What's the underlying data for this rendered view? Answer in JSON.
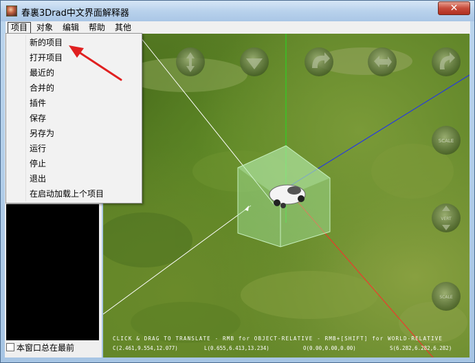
{
  "window": {
    "title": "春裏3Drad中文界面解释器",
    "close_glyph": "✕"
  },
  "menubar": {
    "items": [
      "项目",
      "对象",
      "编辑",
      "帮助",
      "其他"
    ]
  },
  "project_menu": {
    "items": [
      "新的项目",
      "打开项目",
      "最近的",
      "合并的",
      "插件",
      "保存",
      "另存为",
      "运行",
      "停止",
      "退出",
      "在启动加载上个项目"
    ]
  },
  "left_panel": {
    "always_on_top_label": "本窗口总在最前",
    "always_on_top_checked": false
  },
  "viewport": {
    "hint": "CLICK & DRAG TO TRANSLATE - RMB for OBJECT-RELATIVE - RMB+[SHIFT] for WORLD-RELATIVE",
    "coords": {
      "c": "C(2.461,9.554,12.077)",
      "l": "L(0.655,6.413,13.234)",
      "o": "O(0.00,0.00,0.00)",
      "s": "S(6.282,6.282,6.282)"
    },
    "nav_buttons": [
      "move-vertical-icon",
      "move-down-icon",
      "rotate-left-icon",
      "rotate-right-icon",
      "tilt-icon",
      "scale-icon",
      "zoom-vertical-icon",
      "scale-small-icon"
    ],
    "scale_labels": {
      "scale": "SCALE",
      "vert": "VERT",
      "scale2": "SCALE"
    }
  },
  "colors": {
    "axis_x": "#ff2a2a",
    "axis_y": "#22dd22",
    "axis_z": "#1a2aff",
    "annotation_arrow": "#e02020"
  }
}
